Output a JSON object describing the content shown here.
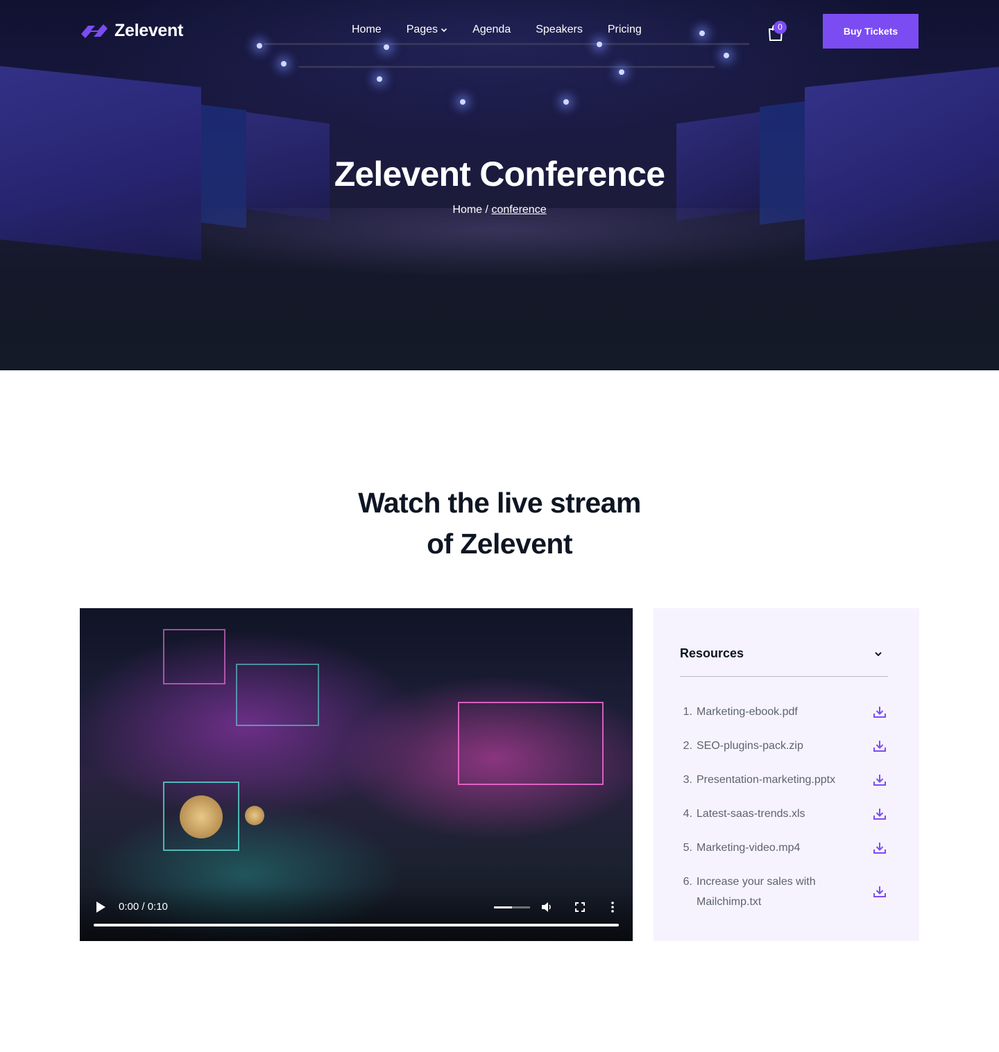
{
  "brand": {
    "name": "Zelevent",
    "accent": "#7b4cf2"
  },
  "nav": {
    "items": [
      {
        "label": "Home"
      },
      {
        "label": "Pages"
      },
      {
        "label": "Agenda"
      },
      {
        "label": "Speakers"
      },
      {
        "label": "Pricing"
      }
    ]
  },
  "cart": {
    "count": "0"
  },
  "header": {
    "cta": "Buy Tickets"
  },
  "hero": {
    "title": "Zelevent Conference",
    "breadcrumb": {
      "home": "Home",
      "separator": "/",
      "current": "conference"
    }
  },
  "section": {
    "title_line1": "Watch the live stream",
    "title_line2": "of Zelevent"
  },
  "video": {
    "time": "0:00 / 0:10",
    "volume_level": 0.5,
    "progress": 0
  },
  "resources": {
    "title": "Resources",
    "items": [
      {
        "num": "1.",
        "name": "Marketing-ebook.pdf"
      },
      {
        "num": "2.",
        "name": "SEO-plugins-pack.zip"
      },
      {
        "num": "3.",
        "name": "Presentation-marketing.pptx"
      },
      {
        "num": "4.",
        "name": "Latest-saas-trends.xls"
      },
      {
        "num": "5.",
        "name": "Marketing-video.mp4"
      },
      {
        "num": "6.",
        "name": "Increase your sales with Mailchimp.txt"
      }
    ]
  }
}
